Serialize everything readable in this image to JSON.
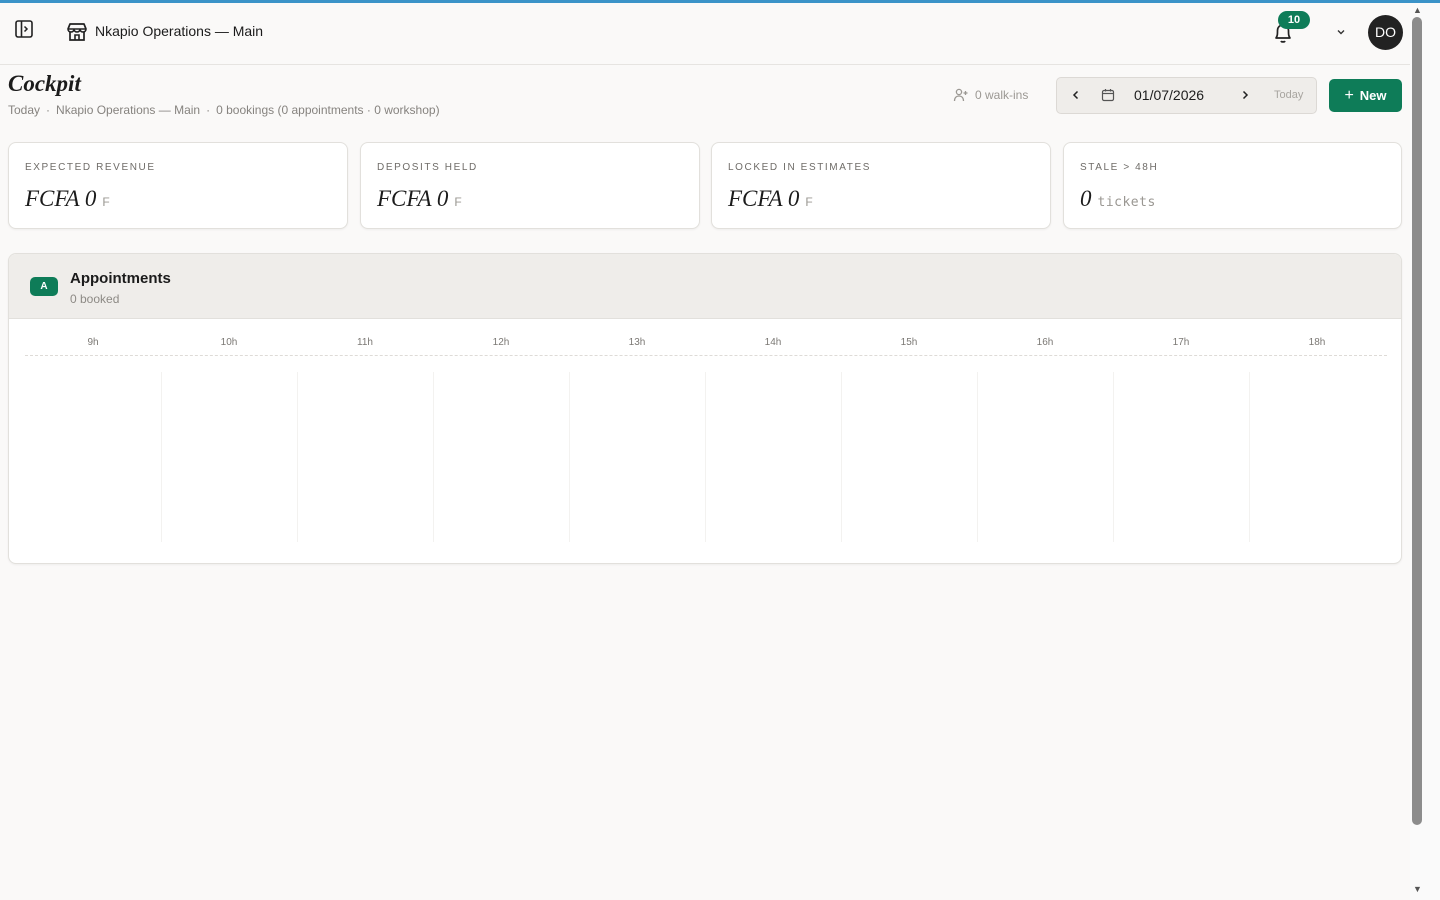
{
  "header": {
    "org_name": "Nkapio Operations — Main",
    "notification_count": "10",
    "avatar_initials": "DO"
  },
  "page": {
    "title": "Cockpit",
    "subtitle": {
      "day": "Today",
      "location": "Nkapio Operations — Main",
      "summary": "0 bookings (0 appointments · 0 workshop)"
    }
  },
  "toolbar": {
    "walk_ins": "0 walk-ins",
    "date": "01/07/2026",
    "today_label": "Today",
    "new_label": "New"
  },
  "stats": [
    {
      "label": "EXPECTED REVENUE",
      "value": "FCFA 0",
      "unit": "F"
    },
    {
      "label": "DEPOSITS HELD",
      "value": "FCFA 0",
      "unit": "F"
    },
    {
      "label": "LOCKED IN ESTIMATES",
      "value": "FCFA 0",
      "unit": "F"
    },
    {
      "label": "STALE > 48H",
      "value": "0",
      "unit": "tickets"
    }
  ],
  "appointments": {
    "badge": "A",
    "title": "Appointments",
    "count": "0 booked",
    "hours": [
      "9h",
      "10h",
      "11h",
      "12h",
      "13h",
      "14h",
      "15h",
      "16h",
      "17h",
      "18h"
    ]
  },
  "colors": {
    "accent": "#0e7c58",
    "top_line": "#3b93c8",
    "background": "#faf9f8"
  },
  "icons": {
    "sidebar_toggle": "sidebar-toggle-icon",
    "store": "store-icon",
    "bell": "bell-icon",
    "walk_in": "user-plus-icon",
    "calendar": "calendar-icon"
  }
}
